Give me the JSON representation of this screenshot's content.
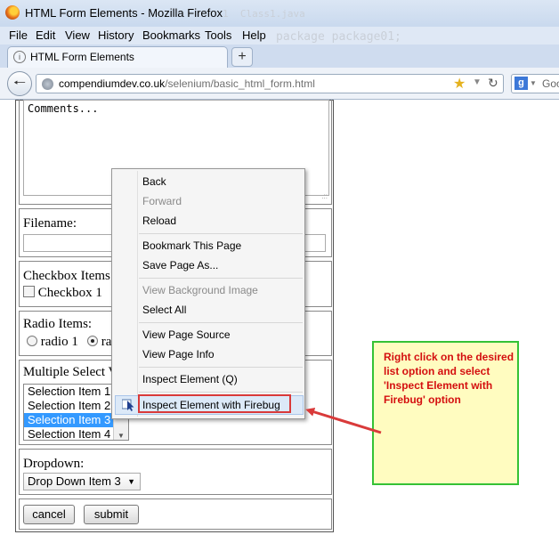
{
  "window": {
    "title": "HTML Form Elements - Mozilla Firefox"
  },
  "menu": [
    "File",
    "Edit",
    "View",
    "History",
    "Bookmarks",
    "Tools",
    "Help"
  ],
  "tab": {
    "label": "HTML Form Elements",
    "new_tab": "+"
  },
  "navbar": {
    "url_host": "compendiumdev.co.uk",
    "url_path": "/selenium/basic_html_form.html",
    "search_text": "Goo"
  },
  "form": {
    "comments_value": "Comments...",
    "filename_label": "Filename:",
    "checkbox_label": "Checkbox Items:",
    "checkbox_item": "Checkbox 1",
    "radio_label": "Radio Items:",
    "radio_1": "radio 1",
    "radio_2": "ra",
    "multi_select_label": "Multiple Select V",
    "multi_select_options": [
      "Selection Item 1",
      "Selection Item 2",
      "Selection Item 3",
      "Selection Item 4"
    ],
    "multi_selected_index": 2,
    "dropdown_label": "Dropdown:",
    "dropdown_value": "Drop Down Item 3",
    "cancel_label": "cancel",
    "submit_label": "submit"
  },
  "context_menu": {
    "back": "Back",
    "forward": "Forward",
    "reload": "Reload",
    "bookmark": "Bookmark This Page",
    "save_page": "Save Page As...",
    "view_bg_image": "View Background Image",
    "select_all": "Select All",
    "view_source": "View Page Source",
    "view_info": "View Page Info",
    "inspect": "Inspect Element (Q)",
    "inspect_firebug": "Inspect Element with Firebug"
  },
  "callout": {
    "text": "Right click on the desired list option and select 'Inspect Element with Firebug' option",
    "border_color": "#35c235",
    "text_color": "#d40f0f"
  }
}
